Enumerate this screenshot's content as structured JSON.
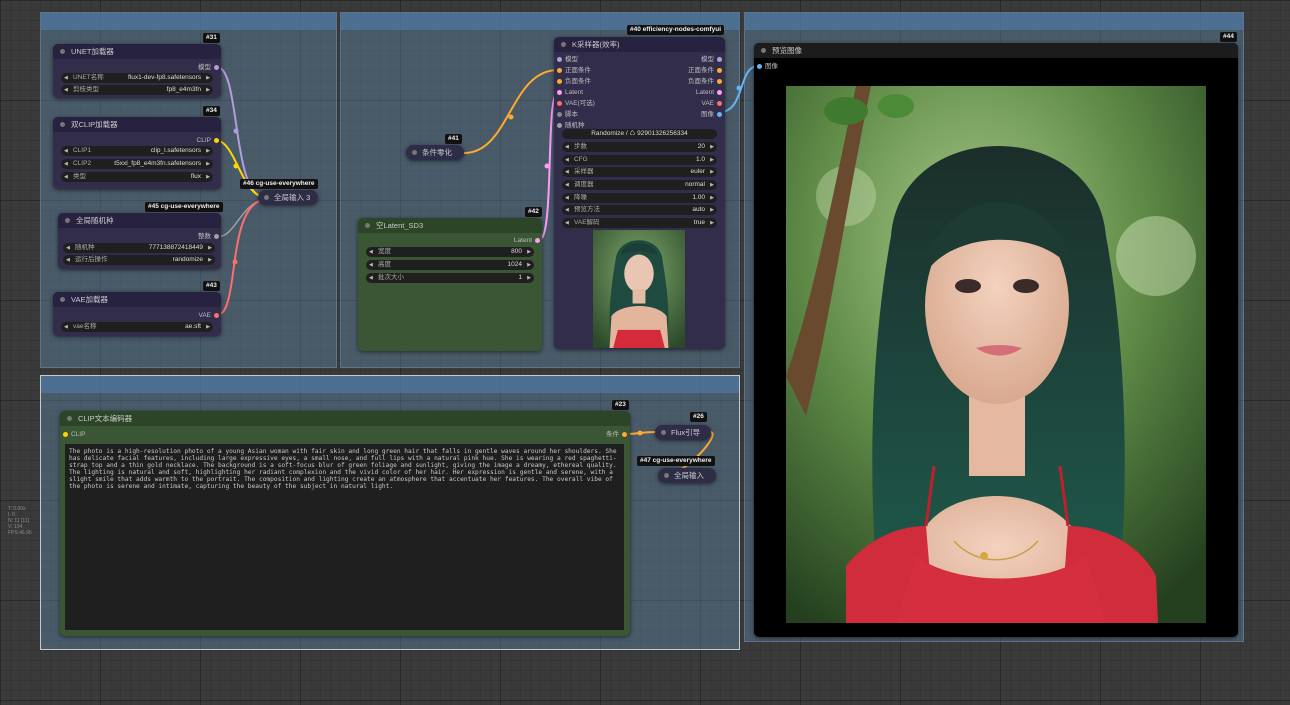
{
  "groups": [
    {
      "label": ""
    },
    {
      "label": ""
    },
    {
      "label": ""
    },
    {
      "label": ""
    }
  ],
  "nodes": {
    "unet": {
      "badge": "#31",
      "title": "UNET加载器",
      "out_label": "模型",
      "widgets": [
        {
          "label": "UNET名称",
          "value": "flux1-dev-fp8.safetensors"
        },
        {
          "label": "剪枝类型",
          "value": "fp8_e4m3fn"
        }
      ]
    },
    "dualclip": {
      "badge": "#34",
      "title": "双CLIP加载器",
      "out_label": "CLIP",
      "widgets": [
        {
          "label": "CLIP1",
          "value": "clip_l.safetensors"
        },
        {
          "label": "CLIP2",
          "value": "t5xxl_fp8_e4m3fn.safetensors"
        },
        {
          "label": "类型",
          "value": "flux"
        }
      ]
    },
    "seed": {
      "badge": "#45 cg-use-everywhere",
      "title": "全局随机种",
      "out_label": "整数",
      "widgets": [
        {
          "label": "随机种",
          "value": "777138872418449"
        },
        {
          "label": "运行后操作",
          "value": "randomize"
        }
      ]
    },
    "vae": {
      "badge": "#43",
      "title": "VAE加载器",
      "out_label": "VAE",
      "widgets": [
        {
          "label": "vae名称",
          "value": "ae.sft"
        }
      ]
    },
    "everywhere46": {
      "badge": "#46 cg-use-everywhere",
      "title": "全局输入 3"
    },
    "condzero": {
      "badge": "#41",
      "title": "条件零化"
    },
    "latent": {
      "badge": "#42",
      "title": "空Latent_SD3",
      "out_label": "Latent",
      "widgets": [
        {
          "label": "宽度",
          "value": "800"
        },
        {
          "label": "高度",
          "value": "1024"
        },
        {
          "label": "批次大小",
          "value": "1"
        }
      ]
    },
    "ksampler": {
      "badge": "#40 efficiency-nodes-comfyui",
      "title": "K采样器(效率)",
      "inputs": [
        "模型",
        "正面条件",
        "负面条件",
        "Latent",
        "VAE(可选)",
        "脚本",
        "随机种"
      ],
      "outputs": [
        "模型",
        "正面条件",
        "负面条件",
        "Latent",
        "VAE",
        "图像"
      ],
      "seed_button": "Randomize / ♺ 92901326256334",
      "widgets": [
        {
          "label": "步数",
          "value": "20"
        },
        {
          "label": "CFG",
          "value": "1.0"
        },
        {
          "label": "采样器",
          "value": "euler"
        },
        {
          "label": "调度器",
          "value": "normal"
        },
        {
          "label": "降噪",
          "value": "1.00"
        },
        {
          "label": "预览方法",
          "value": "auto"
        },
        {
          "label": "VAE解码",
          "value": "true"
        }
      ]
    },
    "preview": {
      "badge": "#44",
      "title": "预览图像",
      "in_label": "图像"
    },
    "cliptext": {
      "badge": "#23",
      "title": "CLIP文本编码器",
      "in_label": "CLIP",
      "out_label": "条件",
      "text": "The photo is a high-resolution photo of a young Asian woman with fair skin and long green hair that falls in gentle waves around her shoulders. She has delicate facial features, including large expressive eyes, a small nose, and full lips with a natural pink hue. She is wearing a red spaghetti-strap top and a thin gold necklace. The background is a soft-focus blur of green foliage and sunlight, giving the image a dreamy, ethereal quality. The lighting is natural and soft, highlighting her radiant complexion and the vivid color of her hair. Her expression is gentle and serene, with a slight smile that adds warmth to the portrait. The composition and lighting create an atmosphere that accentuate her features. The overall vibe of the photo is serene and intimate, capturing the beauty of the subject in natural light."
    },
    "fluxguide": {
      "badge": "#26",
      "title": "Flux引导"
    },
    "everywhere47": {
      "badge": "#47 cg-use-everywhere",
      "title": "全局输入"
    }
  },
  "stats": [
    "T: 0.00s",
    "I: 0",
    "N: 11 [11]",
    "V: 104",
    "FPS:46.95"
  ],
  "colors": {
    "model_wire": "#b39ddb",
    "clip_wire": "#ffd500",
    "cond_wire": "#ffa931",
    "latent_wire": "#ff9cf9",
    "vae_wire": "#ff6e6e",
    "image_wire": "#64b5f6",
    "int_wire": "#a0a0a0"
  }
}
